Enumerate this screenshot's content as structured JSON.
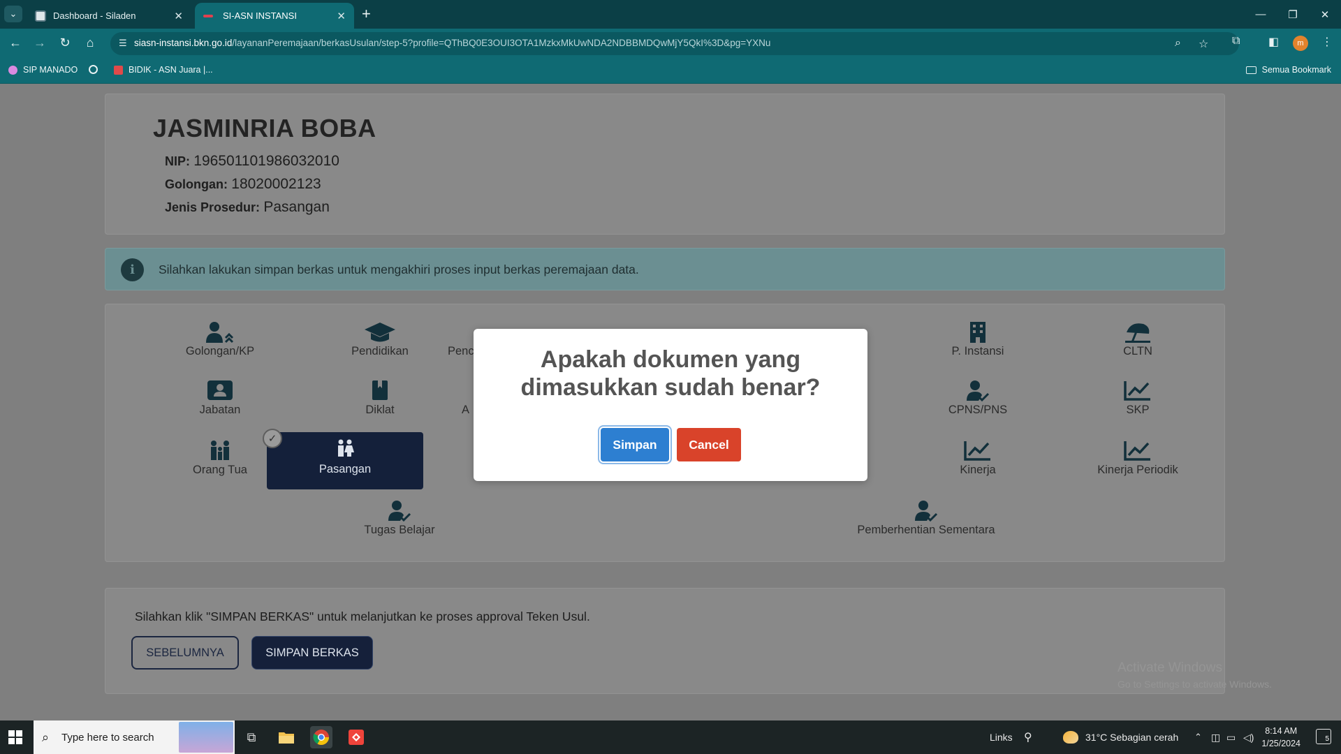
{
  "browser": {
    "tabs": [
      {
        "title": "Dashboard - Siladen",
        "active": false
      },
      {
        "title": "SI-ASN INSTANSI",
        "active": true
      }
    ],
    "url_host": "siasn-instansi.bkn.go.id",
    "url_path": "/layananPeremajaan/berkasUsulan/step-5?profile=QThBQ0E3OUI3OTA1MzkxMkUwNDA2NDBBMDQwMjY5QkI%3D&pg=YXNu",
    "profile_initial": "m",
    "bookmarks": [
      "SIP MANADO",
      "BIDIK - ASN Juara |..."
    ],
    "all_bookmarks_label": "Semua Bookmark"
  },
  "profile": {
    "name": "JASMINRIA BOBA",
    "nip_label": "NIP:",
    "nip_value": "196501101986032010",
    "golongan_label": "Golongan:",
    "golongan_value": "18020002123",
    "prosedur_label": "Jenis Prosedur:",
    "prosedur_value": "Pasangan"
  },
  "alert": {
    "icon": "info-icon",
    "text": "Silahkan lakukan simpan berkas untuk mengakhiri proses input berkas peremajaan data."
  },
  "menu": {
    "items": [
      {
        "label": "Golongan/KP",
        "icon": "user-rank-icon"
      },
      {
        "label": "Pendidikan",
        "icon": "graduation-cap-icon"
      },
      {
        "label": "Penc",
        "icon": "award-icon"
      },
      {
        "label": "P. Instansi",
        "icon": "building-icon"
      },
      {
        "label": "CLTN",
        "icon": "umbrella-beach-icon"
      },
      {
        "label": "Jabatan",
        "icon": "id-badge-icon"
      },
      {
        "label": "Diklat",
        "icon": "book-icon"
      },
      {
        "label": "A",
        "icon": "certificate-icon"
      },
      {
        "label": "CPNS/PNS",
        "icon": "user-check-icon"
      },
      {
        "label": "SKP",
        "icon": "chart-line-icon"
      },
      {
        "label": "Orang Tua",
        "icon": "family-icon"
      },
      {
        "label": "Pasangan",
        "icon": "couple-icon",
        "active": true
      },
      {
        "label": "Kinerja",
        "icon": "chart-line-icon"
      },
      {
        "label": "Kinerja Periodik",
        "icon": "chart-line-icon"
      },
      {
        "label": "Tugas Belajar",
        "icon": "user-check-icon"
      },
      {
        "label": "Pemberhentian Sementara",
        "icon": "user-check-icon"
      }
    ]
  },
  "footer": {
    "instruction": "Silahkan klik \"SIMPAN BERKAS\" untuk melanjutkan ke proses approval Teken Usul.",
    "prev_label": "SEBELUMNYA",
    "save_label": "SIMPAN BERKAS"
  },
  "modal": {
    "title_line1": "Apakah dokumen yang",
    "title_line2": "dimasukkan sudah benar?",
    "confirm_label": "Simpan",
    "cancel_label": "Cancel"
  },
  "watermark": {
    "line1": "Activate Windows",
    "line2": "Go to Settings to activate Windows."
  },
  "taskbar": {
    "search_placeholder": "Type here to search",
    "links_label": "Links",
    "weather": "31°C  Sebagian cerah",
    "time": "8:14 AM",
    "date": "1/25/2024",
    "notification_count": "5"
  },
  "colors": {
    "browser_frame": "#0f6a73",
    "tab_bar": "#0b3f46",
    "active_menu": "#14203a",
    "confirm_button": "#2d7fd1",
    "cancel_button": "#d9432a"
  }
}
